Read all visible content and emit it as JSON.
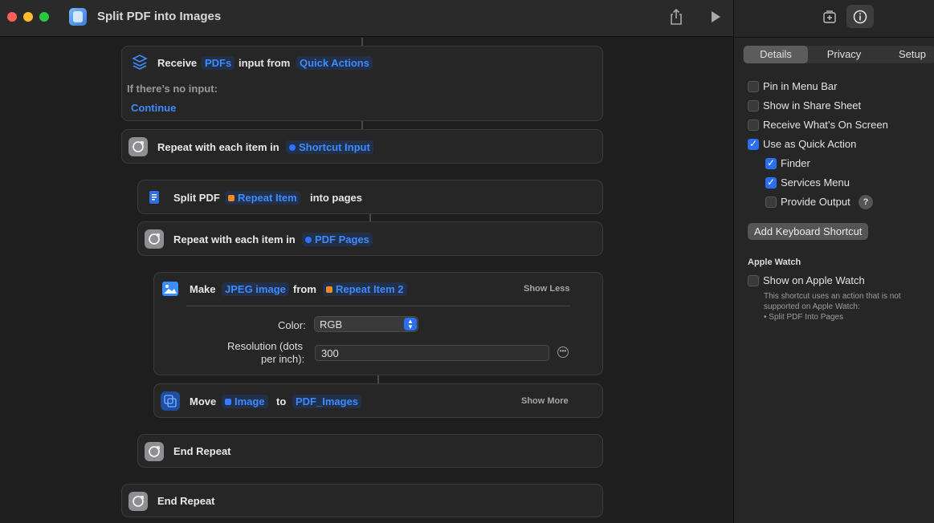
{
  "window": {
    "title": "Split PDF into Images"
  },
  "colors": {
    "accent": "#3d8bff",
    "background": "#1e1e1e",
    "card": "#262626",
    "variable_orange": "#f08a24"
  },
  "actions": {
    "receive": {
      "verb": "Receive",
      "type_token": "PDFs",
      "middle": "input from",
      "source_token": "Quick Actions",
      "no_input_label": "If there’s no input:",
      "no_input_value": "Continue"
    },
    "repeat_outer": {
      "label": "Repeat with each item in",
      "token": "Shortcut Input"
    },
    "split_pdf": {
      "verb": "Split PDF",
      "token": "Repeat Item",
      "suffix": "into pages"
    },
    "repeat_inner": {
      "label": "Repeat with each item in",
      "token": "PDF Pages"
    },
    "make_image": {
      "verb": "Make",
      "format_token": "JPEG image",
      "middle": "from",
      "source_token": "Repeat Item 2",
      "toggle": "Show Less",
      "color_label": "Color:",
      "color_value": "RGB",
      "resolution_label_1": "Resolution (dots",
      "resolution_label_2": "per inch):",
      "resolution_value": "300"
    },
    "move": {
      "verb": "Move",
      "item_token": "Image",
      "middle": "to",
      "dest_token": "PDF_Images",
      "toggle": "Show More"
    },
    "end_repeat_inner": {
      "label": "End Repeat"
    },
    "end_repeat_outer": {
      "label": "End Repeat"
    }
  },
  "sidebar": {
    "tabs": [
      "Details",
      "Privacy",
      "Setup"
    ],
    "active_tab": "Details",
    "options": [
      {
        "label": "Pin in Menu Bar",
        "checked": false
      },
      {
        "label": "Show in Share Sheet",
        "checked": false
      },
      {
        "label": "Receive What’s On Screen",
        "checked": false
      },
      {
        "label": "Use as Quick Action",
        "checked": true
      },
      {
        "label": "Finder",
        "checked": true
      },
      {
        "label": "Services Menu",
        "checked": true
      },
      {
        "label": "Provide Output",
        "checked": false
      }
    ],
    "help_glyph": "?",
    "keyboard_button": "Add Keyboard Shortcut",
    "apple_watch": {
      "title": "Apple Watch",
      "option": "Show on Apple Watch",
      "checked": false,
      "note_1": "This shortcut uses an action that is not",
      "note_2": "supported on Apple Watch:",
      "note_3": "• Split PDF Into Pages"
    }
  }
}
